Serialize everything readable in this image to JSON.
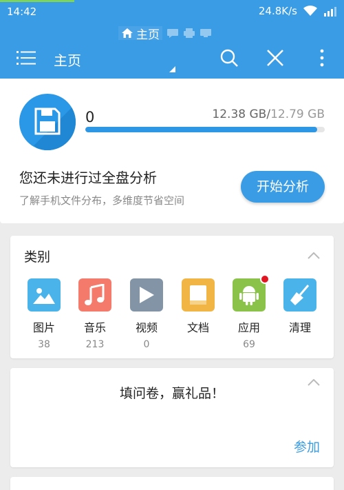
{
  "status_bar": {
    "time": "14:42",
    "network_speed": "24.8K/s"
  },
  "app_bar": {
    "breadcrumb_home": "主页",
    "title": "主页",
    "breadcrumb_icons": [
      "chat-icon",
      "printer-icon",
      "tv-icon"
    ]
  },
  "storage": {
    "used_count": "0",
    "used": "12.38 GB",
    "separator": "/",
    "total": "12.79 GB",
    "used_fraction": 0.968,
    "analyze_title": "您还未进行过全盘分析",
    "analyze_subtitle": "了解手机文件分布，多维度节省空间",
    "analyze_button": "开始分析"
  },
  "categories": {
    "title": "类别",
    "items": [
      {
        "name": "图片",
        "count": "38",
        "icon": "image-icon",
        "color": "#4ab3ea"
      },
      {
        "name": "音乐",
        "count": "213",
        "icon": "music-icon",
        "color": "#f47a6b"
      },
      {
        "name": "视频",
        "count": "0",
        "icon": "video-icon",
        "color": "#8294a6"
      },
      {
        "name": "文档",
        "count": "",
        "icon": "document-icon",
        "color": "#f0b544"
      },
      {
        "name": "应用",
        "count": "69",
        "icon": "android-icon",
        "color": "#8bc34a",
        "badge": true
      },
      {
        "name": "清理",
        "count": "",
        "icon": "broom-icon",
        "color": "#4ab3ea"
      }
    ]
  },
  "survey": {
    "title": "填问卷，赢礼品！",
    "join": "参加"
  },
  "colors": {
    "primary": "#3a9ce4",
    "accent_green": "#7ed35a",
    "badge_red": "#e01622"
  }
}
